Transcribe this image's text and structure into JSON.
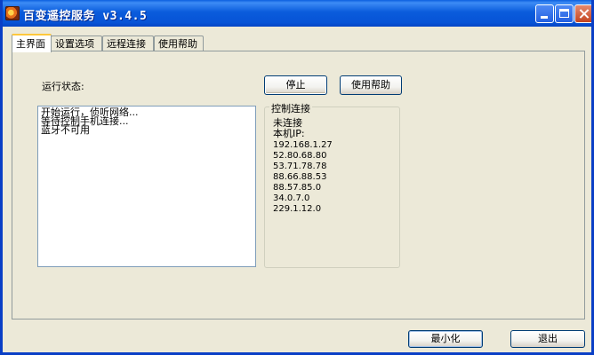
{
  "window": {
    "title": "百变遥控服务 v3.4.5",
    "icon": "app-logo-icon"
  },
  "tabs": [
    {
      "label": "主界面",
      "active": true
    },
    {
      "label": "设置选项",
      "active": false
    },
    {
      "label": "远程连接",
      "active": false
    },
    {
      "label": "使用帮助",
      "active": false
    }
  ],
  "main": {
    "status_label": "运行状态:",
    "log_lines": [
      "开始运行，侦听网络...",
      "等待控制手机连接...",
      "蓝牙不可用"
    ],
    "stop_label": "停止",
    "help_label": "使用帮助",
    "connection": {
      "group_title": "控制连接",
      "status": "未连接",
      "ip_label": "本机IP:",
      "ips": [
        "192.168.1.27",
        "52.80.68.80",
        "53.71.78.78",
        "88.66.88.53",
        "88.57.85.0",
        "34.0.7.0",
        "229.1.12.0"
      ]
    }
  },
  "footer": {
    "minimize_label": "最小化",
    "exit_label": "退出"
  },
  "colors": {
    "titlebar": "#0a5cdc",
    "window_bg": "#ece9d8",
    "active_tab_accent": "#ffc83c",
    "button_border": "#003c74"
  }
}
